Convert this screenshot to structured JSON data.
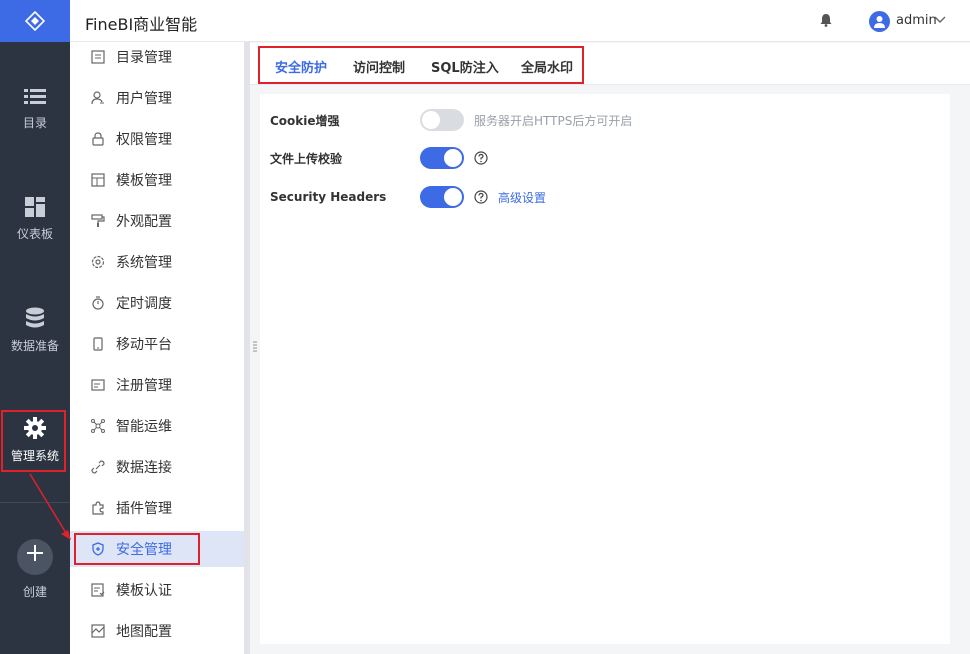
{
  "app": {
    "title": "FineBI商业智能"
  },
  "user": {
    "name": "admin"
  },
  "rail": {
    "items": [
      {
        "label": "目录",
        "icon": "list-icon"
      },
      {
        "label": "仪表板",
        "icon": "dashboard-icon"
      },
      {
        "label": "数据准备",
        "icon": "database-icon"
      },
      {
        "label": "管理系统",
        "icon": "gear-icon"
      },
      {
        "label": "创建",
        "icon": "plus-icon"
      }
    ]
  },
  "menu": {
    "items": [
      {
        "label": "目录管理",
        "icon": "catalog-icon"
      },
      {
        "label": "用户管理",
        "icon": "user-icon"
      },
      {
        "label": "权限管理",
        "icon": "lock-icon"
      },
      {
        "label": "模板管理",
        "icon": "template-icon"
      },
      {
        "label": "外观配置",
        "icon": "paint-roller-icon"
      },
      {
        "label": "系统管理",
        "icon": "settings-icon"
      },
      {
        "label": "定时调度",
        "icon": "timer-icon"
      },
      {
        "label": "移动平台",
        "icon": "mobile-icon"
      },
      {
        "label": "注册管理",
        "icon": "register-icon"
      },
      {
        "label": "智能运维",
        "icon": "network-icon"
      },
      {
        "label": "数据连接",
        "icon": "link-icon"
      },
      {
        "label": "插件管理",
        "icon": "puzzle-icon"
      },
      {
        "label": "安全管理",
        "icon": "shield-icon"
      },
      {
        "label": "模板认证",
        "icon": "certify-icon"
      },
      {
        "label": "地图配置",
        "icon": "map-icon"
      }
    ],
    "active": "安全管理"
  },
  "tabs": {
    "items": [
      "安全防护",
      "访问控制",
      "SQL防注入",
      "全局水印"
    ],
    "active": "安全防护"
  },
  "settings": {
    "cookie": {
      "label": "Cookie增强",
      "enabled": false,
      "hint": "服务器开启HTTPS后方可开启"
    },
    "upload": {
      "label": "文件上传校验",
      "enabled": true
    },
    "headers": {
      "label": "Security Headers",
      "enabled": true,
      "link": "高级设置"
    }
  },
  "colors": {
    "accent": "#3d6be5",
    "rail": "#2c3441",
    "annotation": "#e0202b"
  }
}
